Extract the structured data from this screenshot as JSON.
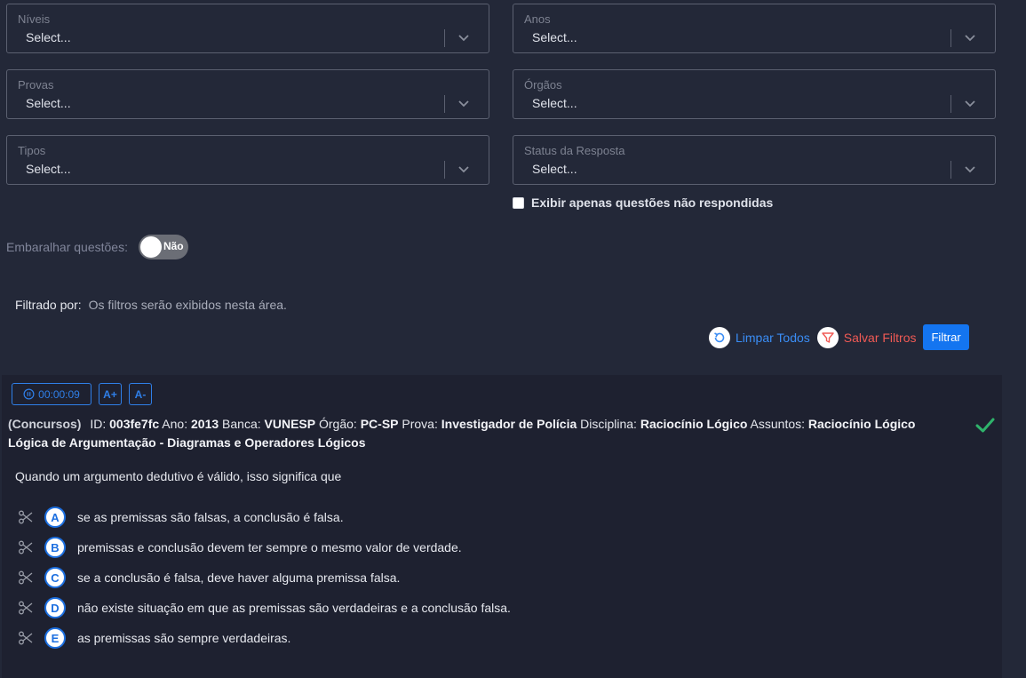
{
  "filters": {
    "niveis": {
      "label": "Níveis",
      "value": "Select..."
    },
    "anos": {
      "label": "Anos",
      "value": "Select..."
    },
    "provas": {
      "label": "Provas",
      "value": "Select..."
    },
    "orgaos": {
      "label": "Órgãos",
      "value": "Select..."
    },
    "tipos": {
      "label": "Tipos",
      "value": "Select..."
    },
    "status": {
      "label": "Status da Resposta",
      "value": "Select..."
    },
    "only_unanswered_label": "Exibir apenas questões não respondidas"
  },
  "shuffle": {
    "label": "Embaralhar questões:",
    "toggle_text": "Não"
  },
  "filtered_by": {
    "label": "Filtrado por:",
    "value": "Os filtros serão exibidos nesta área."
  },
  "actions": {
    "clear_all": "Limpar Todos",
    "save_filters": "Salvar Filtros",
    "filter": "Filtrar"
  },
  "question": {
    "timer": "00:00:09",
    "font_increase": "A+",
    "font_decrease": "A-",
    "source": "(Concursos)",
    "id_label": "ID:",
    "id_value": "003fe7fc",
    "year_label": "Ano:",
    "year_value": "2013",
    "board_label": "Banca:",
    "board_value": "VUNESP",
    "org_label": "Órgão:",
    "org_value": "PC-SP",
    "exam_label": "Prova:",
    "exam_value": "Investigador de Polícia",
    "discipline_label": "Disciplina:",
    "discipline_value": "Raciocínio Lógico",
    "subjects_label": "Assuntos:",
    "subjects_value": "Raciocínio Lógico Lógica de Argumentação - Diagramas e Operadores Lógicos",
    "statement": "Quando um argumento dedutivo é válido, isso significa que",
    "options": [
      {
        "letter": "A",
        "text": "se as premissas são falsas, a conclusão é falsa."
      },
      {
        "letter": "B",
        "text": "premissas e conclusão devem ter sempre o mesmo valor de verdade."
      },
      {
        "letter": "C",
        "text": "se a conclusão é falsa, deve haver alguma premissa falsa."
      },
      {
        "letter": "D",
        "text": "não existe situação em que as premissas são verdadeiras e a conclusão falsa."
      },
      {
        "letter": "E",
        "text": "as premissas são sempre verdadeiras."
      }
    ]
  },
  "colors": {
    "accent": "#1475f0",
    "danger": "#f05a55",
    "success": "#2fb36b",
    "background": "#232838"
  }
}
